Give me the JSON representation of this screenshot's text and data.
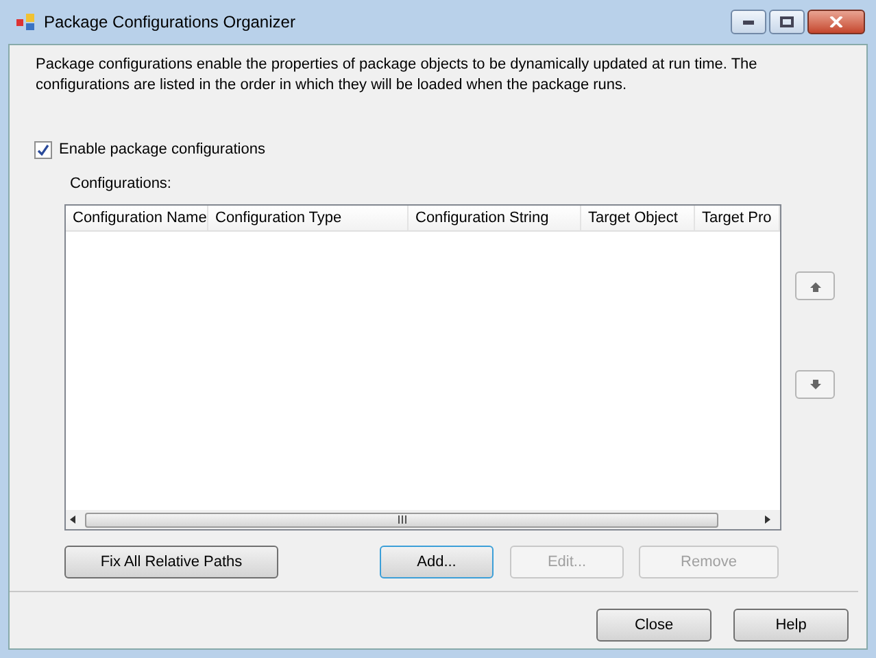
{
  "window": {
    "title": "Package Configurations Organizer"
  },
  "description": "Package configurations enable the properties of package objects to be dynamically updated at run time. The configurations are listed in the order in which they will be loaded when the package runs.",
  "enable_checkbox": {
    "label": "Enable package configurations",
    "checked": true
  },
  "configurations_label": "Configurations:",
  "table": {
    "columns": [
      "Configuration Name",
      "Configuration Type",
      "Configuration String",
      "Target Object",
      "Target Pro"
    ]
  },
  "table_buttons": [
    {
      "label": "Fix All Relative Paths",
      "disabled": false,
      "focused": false
    },
    {
      "label": "Add...",
      "disabled": false,
      "focused": true
    },
    {
      "label": "Edit...",
      "disabled": true,
      "focused": false
    },
    {
      "label": "Remove",
      "disabled": true,
      "focused": false
    }
  ],
  "footer_buttons": [
    {
      "label": "Close"
    },
    {
      "label": "Help"
    }
  ]
}
